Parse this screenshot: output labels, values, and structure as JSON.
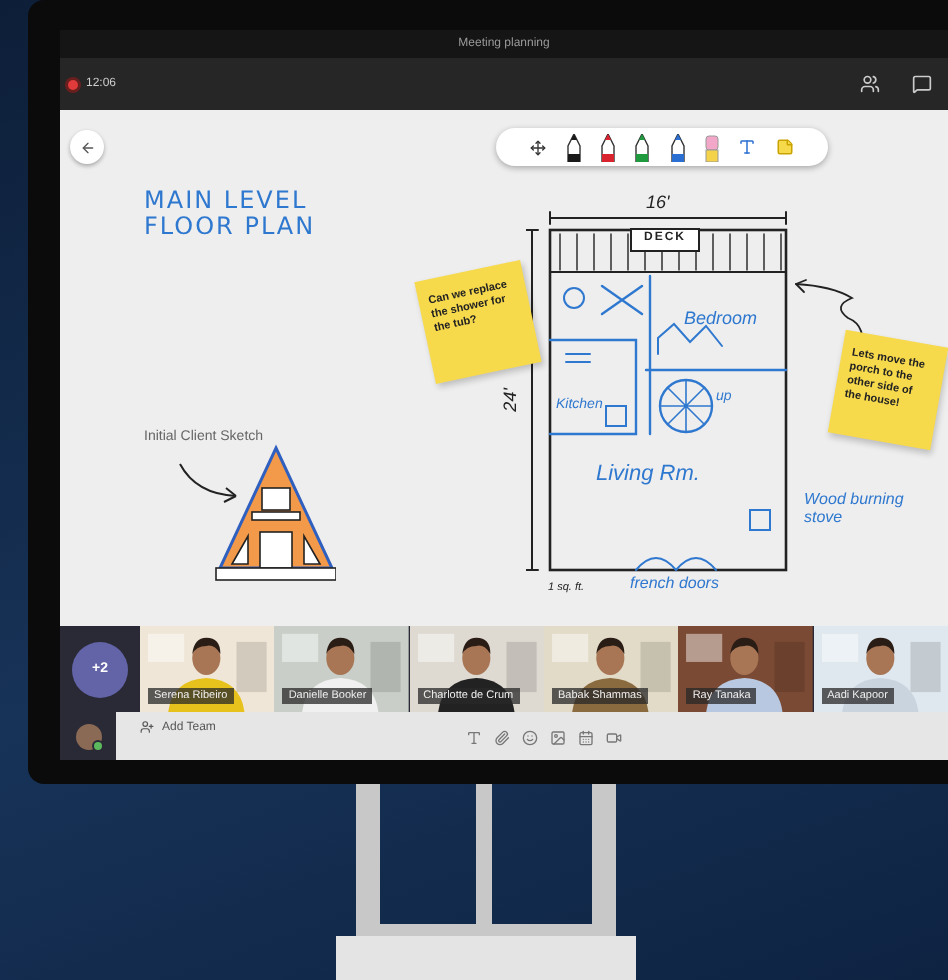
{
  "window": {
    "title": "Meeting planning"
  },
  "top_bar": {
    "recording": true,
    "time": "12:06"
  },
  "toolbar": {
    "tools": [
      {
        "kind": "move"
      },
      {
        "kind": "pen",
        "color": "#1a1a1a"
      },
      {
        "kind": "pen",
        "color": "#d9232e"
      },
      {
        "kind": "pen",
        "color": "#1f9a3f"
      },
      {
        "kind": "pen",
        "color": "#2a6fd1"
      },
      {
        "kind": "eraser"
      },
      {
        "kind": "text"
      },
      {
        "kind": "note"
      }
    ]
  },
  "whiteboard": {
    "title_lines": [
      "MAIN LEVEL",
      "FLOOR PLAN"
    ],
    "caption": "Initial Client Sketch",
    "notes": [
      {
        "text": "Can we replace the shower for the tub?"
      },
      {
        "text": "Lets move the porch to the other side of the house!"
      }
    ],
    "plan_labels": [
      {
        "kind": "width",
        "text": "16'"
      },
      {
        "kind": "deck",
        "text": "DECK"
      },
      {
        "kind": "bedroom",
        "text": "Bedroom"
      },
      {
        "kind": "kitchen",
        "text": "Kitchen"
      },
      {
        "kind": "stairs",
        "text": "up"
      },
      {
        "kind": "living",
        "text": "Living Rm."
      },
      {
        "kind": "stove",
        "text": "Wood burning stove"
      },
      {
        "kind": "doors",
        "text": "french doors"
      },
      {
        "kind": "height",
        "text": "24'"
      },
      {
        "kind": "scale",
        "text": "1 sq. ft."
      }
    ]
  },
  "participants": {
    "overflow": "+2",
    "tiles": [
      {
        "name": "Serena Ribeiro"
      },
      {
        "name": "Danielle Booker"
      },
      {
        "name": "Charlotte de Crum"
      },
      {
        "name": "Babak Shammas"
      },
      {
        "name": "Ray Tanaka"
      },
      {
        "name": "Aadi Kapoor"
      }
    ]
  },
  "bottom_bar": {
    "add_team": "Add Team"
  }
}
